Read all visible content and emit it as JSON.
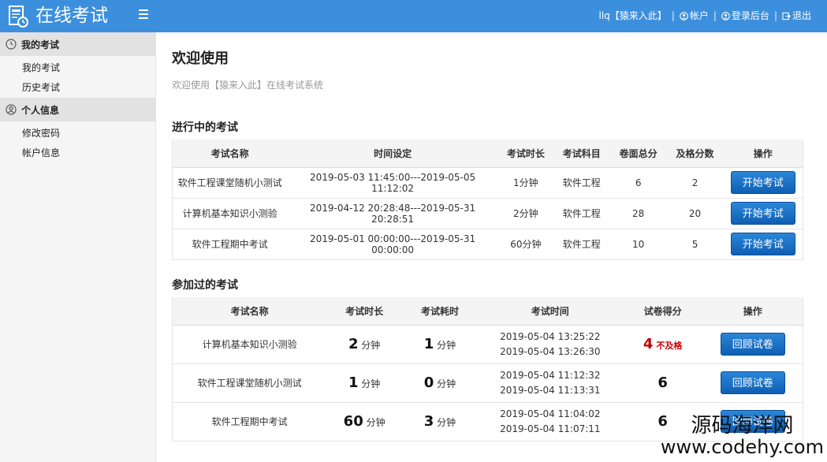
{
  "header": {
    "app_title": "在线考试",
    "user_label": "llq【猿来入此】",
    "account_label": "帐户",
    "admin_label": "登录后台",
    "logout_label": "退出",
    "bg_color": "#3c8fdc"
  },
  "sidebar": {
    "groups": [
      {
        "label": "我的考试",
        "icon": "clock-icon",
        "items": [
          "我的考试",
          "历史考试"
        ]
      },
      {
        "label": "个人信息",
        "icon": "user-icon",
        "items": [
          "修改密码",
          "帐户信息"
        ]
      }
    ]
  },
  "main": {
    "title": "欢迎使用",
    "subtitle": "欢迎使用【猿来入此】在线考试系统",
    "ongoing": {
      "title": "进行中的考试",
      "headers": [
        "考试名称",
        "时间设定",
        "考试时长",
        "考试科目",
        "卷面总分",
        "及格分数",
        "操作"
      ],
      "rows": [
        {
          "name": "软件工程课堂随机小测试",
          "time": "2019-05-03 11:45:00---2019-05-05 11:12:02",
          "duration": "1分钟",
          "subject": "软件工程",
          "total": "6",
          "pass": "2",
          "action": "开始考试"
        },
        {
          "name": "计算机基本知识小测验",
          "time": "2019-04-12 20:28:48---2019-05-31 20:28:51",
          "duration": "2分钟",
          "subject": "软件工程",
          "total": "28",
          "pass": "20",
          "action": "开始考试"
        },
        {
          "name": "软件工程期中考试",
          "time": "2019-05-01 00:00:00---2019-05-31 00:00:00",
          "duration": "60分钟",
          "subject": "软件工程",
          "total": "10",
          "pass": "5",
          "action": "开始考试"
        }
      ]
    },
    "taken": {
      "title": "参加过的考试",
      "headers": [
        "考试名称",
        "考试时长",
        "考试耗时",
        "考试时间",
        "试卷得分",
        "操作"
      ],
      "rows": [
        {
          "name": "计算机基本知识小测验",
          "duration_num": "2",
          "duration_unit": "分钟",
          "used_num": "1",
          "used_unit": "分钟",
          "start": "2019-05-04 13:25:22",
          "end": "2019-05-04 13:26:30",
          "score": "4",
          "status": "不及格",
          "action": "回顾试卷"
        },
        {
          "name": "软件工程课堂随机小测试",
          "duration_num": "1",
          "duration_unit": "分钟",
          "used_num": "0",
          "used_unit": "分钟",
          "start": "2019-05-04 11:12:32",
          "end": "2019-05-04 11:13:31",
          "score": "6",
          "status": "",
          "action": "回顾试卷"
        },
        {
          "name": "软件工程期中考试",
          "duration_num": "60",
          "duration_unit": "分钟",
          "used_num": "3",
          "used_unit": "分钟",
          "start": "2019-05-04 11:04:02",
          "end": "2019-05-04 11:07:11",
          "score": "6",
          "status": "",
          "action": "回顾试卷"
        }
      ]
    }
  },
  "watermark": {
    "line1": "源码海洋网",
    "line2": "www.codehy.com"
  }
}
